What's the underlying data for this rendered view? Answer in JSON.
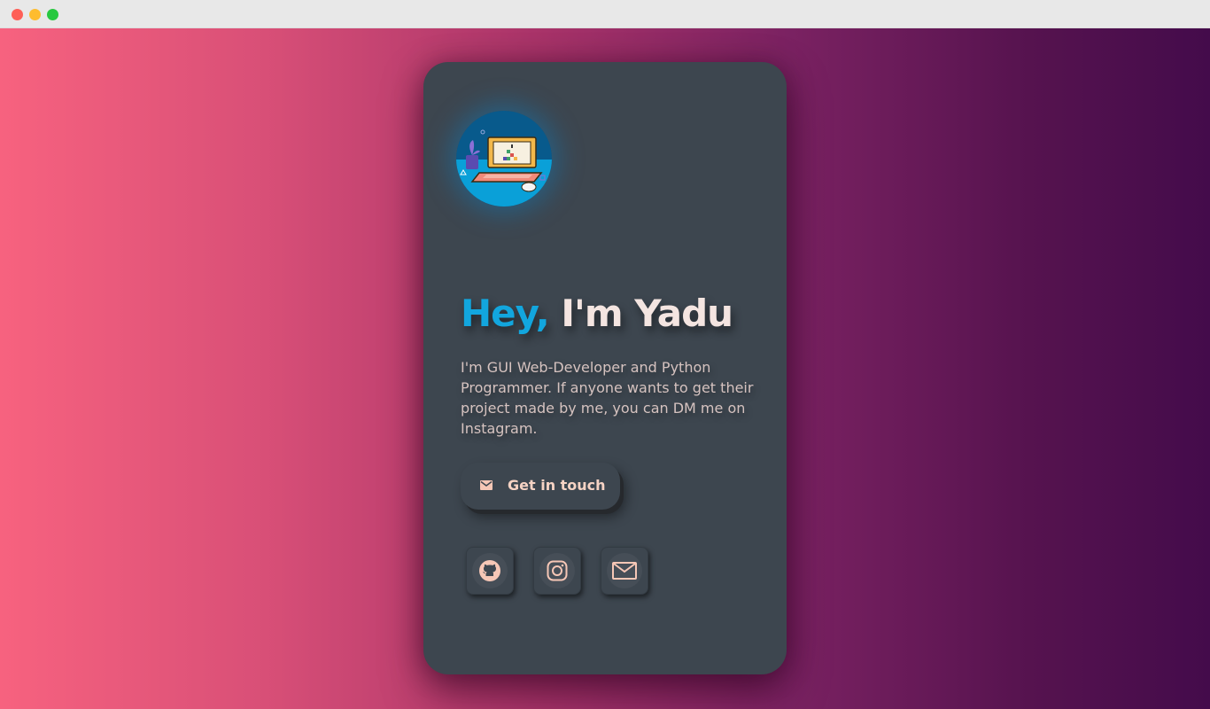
{
  "heading": {
    "accent": "Hey,",
    "name": "I'm Yadu"
  },
  "bio": "I'm GUI Web-Developer and Python Programmer. If anyone wants to get their project made by me, you can DM me on Instagram.",
  "cta": {
    "label": "Get in touch",
    "icon": "mail-icon"
  },
  "social_links": [
    {
      "name": "github",
      "icon": "github-icon"
    },
    {
      "name": "instagram",
      "icon": "instagram-icon"
    },
    {
      "name": "email",
      "icon": "mail-icon"
    }
  ],
  "colors": {
    "card_background": "#3d464f",
    "accent": "#12a6de",
    "name_text": "#f4e5e1",
    "body_text": "#d6c3c0",
    "icon_color": "#f6c7b6",
    "gradient_start": "#f7627f",
    "gradient_end": "#440b4b"
  }
}
